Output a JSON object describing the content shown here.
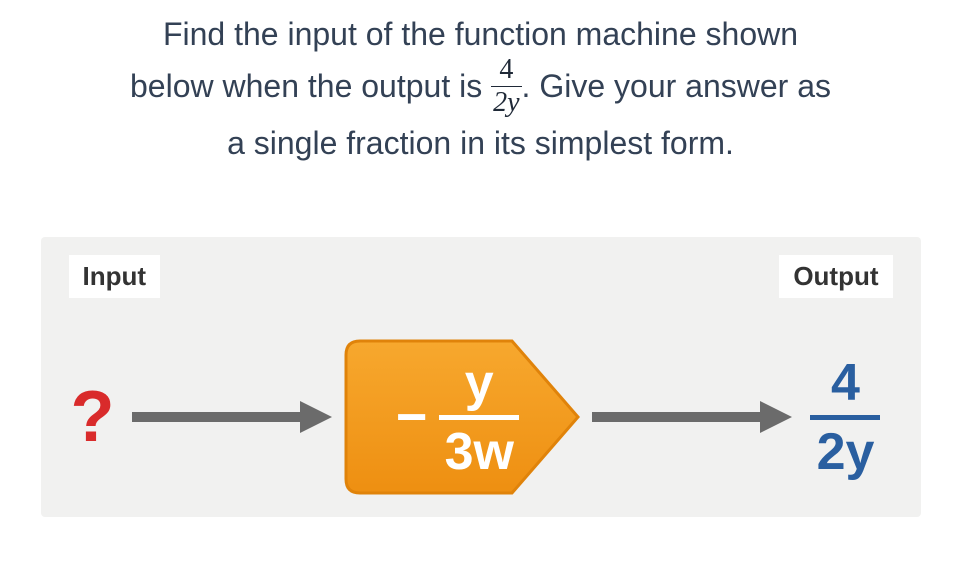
{
  "question": {
    "line1": "Find the input of the function machine shown",
    "line2_before": "below when the output is ",
    "line2_after": ". Give your answer as",
    "line3": "a single fraction in its simplest form.",
    "target_frac": {
      "num": "4",
      "den": "2y"
    }
  },
  "machine": {
    "input_label": "Input",
    "output_label": "Output",
    "input_value": "?",
    "operation": {
      "sign": "−",
      "frac": {
        "num": "y",
        "den": "3w"
      }
    },
    "output_value": {
      "num": "4",
      "den": "2y"
    }
  },
  "colors": {
    "question_text": "#334155",
    "panel_bg": "#f1f1f0",
    "input_q": "#d92b2b",
    "op_fill": "#f39b1a",
    "op_stroke": "#e0830a",
    "arrow": "#6b6b6b",
    "output_frac": "#2a5fa0"
  }
}
